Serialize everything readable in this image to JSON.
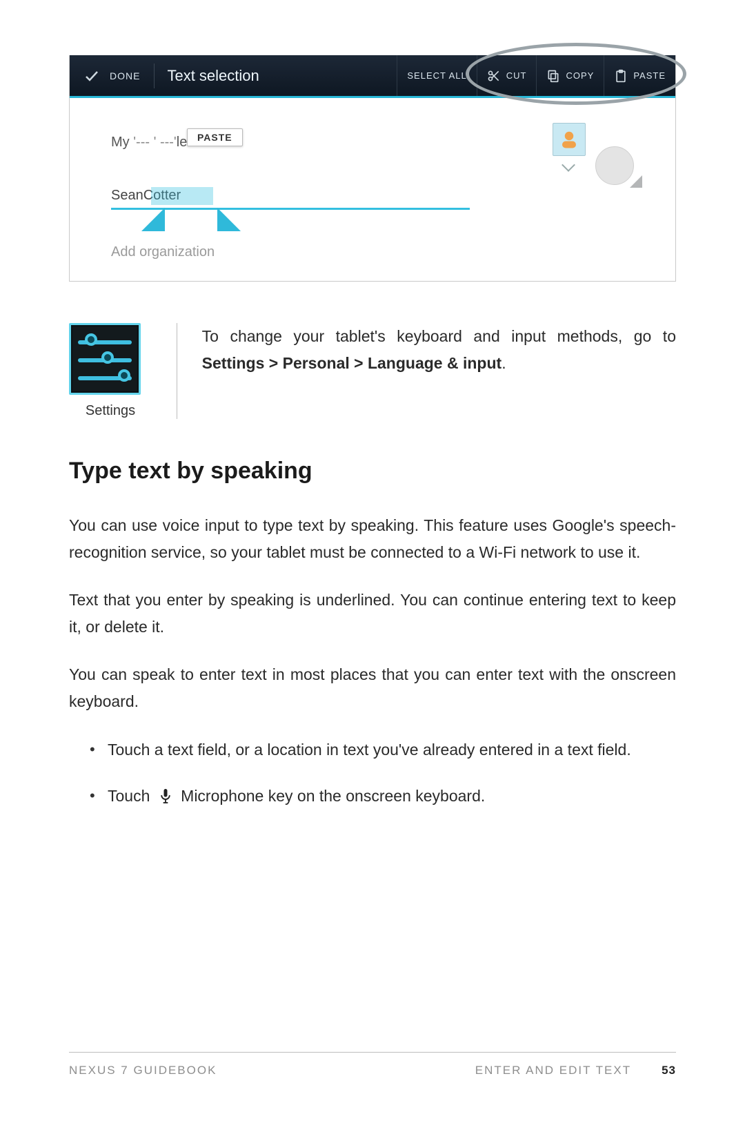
{
  "action_bar": {
    "done_label": "DONE",
    "title": "Text selection",
    "select_all_label": "SELECT ALL",
    "cut_label": "CUT",
    "copy_label": "COPY",
    "paste_label": "PASTE"
  },
  "contact_form": {
    "profile_prefix": "My ",
    "profile_obscured": "'--- ' ---'",
    "profile_suffix": "le",
    "paste_chip": "PASTE",
    "name_first": "Sean ",
    "name_selected": "Cotter",
    "add_org": "Add organization"
  },
  "tip": {
    "icon_label": "Settings",
    "text_before": "To change your tablet's keyboard and input methods, go to ",
    "text_bold": "Settings > Personal > Language & input",
    "text_after": "."
  },
  "section_heading": "Type text by speaking",
  "paragraphs": {
    "p1": "You can use voice input to type text by speaking. This feature uses Google's speech-recognition service, so your tablet must be connected to a Wi-Fi network to use it.",
    "p2": "Text that you enter by speaking is underlined. You can continue entering text to keep it, or delete it.",
    "p3": "You can speak to enter text in most places that you can enter text with the onscreen keyboard."
  },
  "steps": {
    "s1": "Touch a text field, or a location in text you've already entered in a text field.",
    "s2_before": "Touch ",
    "s2_after": " Microphone key on the onscreen keyboard."
  },
  "footer": {
    "left": "NEXUS 7 GUIDEBOOK",
    "right_section": "ENTER AND EDIT TEXT",
    "page": "53"
  }
}
